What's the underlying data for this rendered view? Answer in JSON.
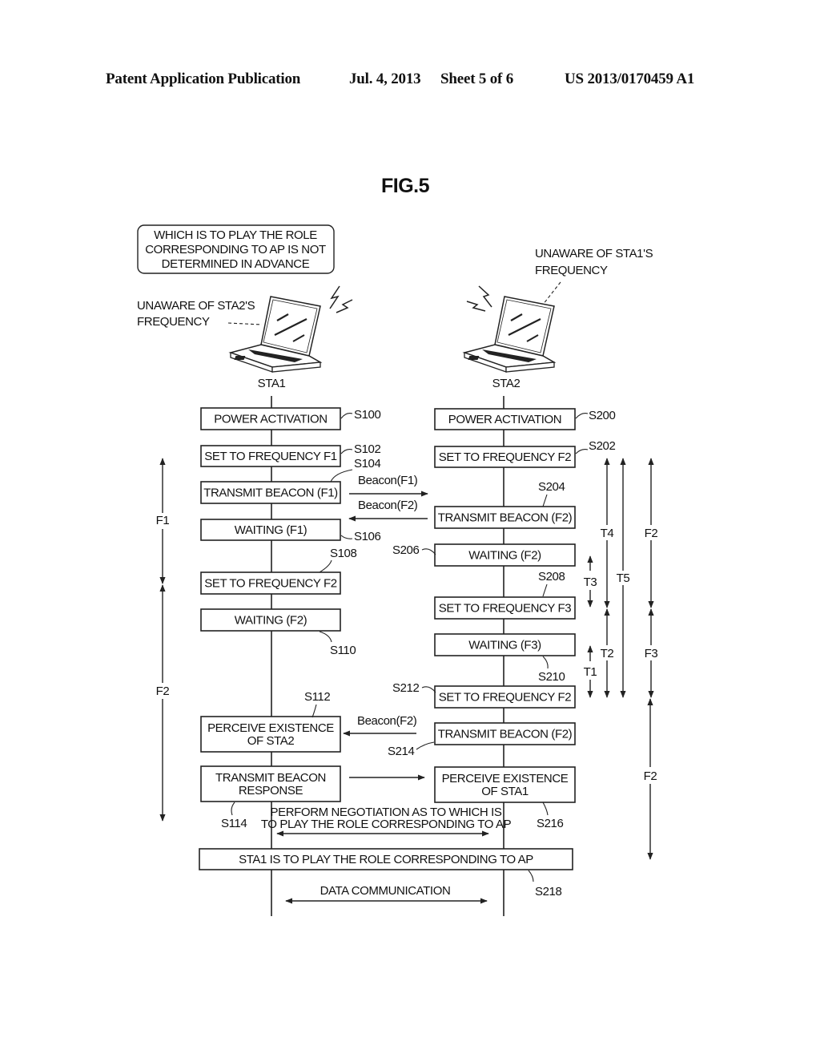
{
  "header": {
    "publication": "Patent Application Publication",
    "date": "Jul. 4, 2013",
    "sheet": "Sheet 5 of 6",
    "number": "US 2013/0170459 A1"
  },
  "figure": {
    "title": "FIG.5",
    "note_box": [
      "WHICH IS TO PLAY THE ROLE",
      "CORRESPONDING TO AP IS NOT",
      "DETERMINED IN ADVANCE"
    ],
    "sta1": {
      "label": "STA1",
      "note": [
        "UNAWARE OF STA2'S",
        "FREQUENCY"
      ],
      "icon": "laptop-icon"
    },
    "sta2": {
      "label": "STA2",
      "note": [
        "UNAWARE OF STA1'S",
        "FREQUENCY"
      ],
      "icon": "laptop-icon"
    },
    "sta1_steps": [
      {
        "id": "S100",
        "text": [
          "POWER ACTIVATION"
        ]
      },
      {
        "id": "S102",
        "text": [
          "SET TO FREQUENCY F1"
        ]
      },
      {
        "id": "S104",
        "text": [
          "TRANSMIT BEACON (F1)"
        ]
      },
      {
        "id": "S106",
        "text": [
          "WAITING (F1)"
        ]
      },
      {
        "id": "S108",
        "text": [
          "SET TO FREQUENCY F2"
        ]
      },
      {
        "id": "S110",
        "text": [
          "WAITING (F2)"
        ]
      },
      {
        "id": "S112",
        "text": [
          "PERCEIVE EXISTENCE",
          "OF STA2"
        ]
      },
      {
        "id": "S114",
        "text": [
          "TRANSMIT BEACON",
          "RESPONSE"
        ]
      }
    ],
    "sta2_steps": [
      {
        "id": "S200",
        "text": [
          "POWER ACTIVATION"
        ]
      },
      {
        "id": "S202",
        "text": [
          "SET TO FREQUENCY F2"
        ]
      },
      {
        "id": "S204",
        "text": [
          "TRANSMIT BEACON (F2)"
        ]
      },
      {
        "id": "S206",
        "text": [
          "WAITING (F2)"
        ]
      },
      {
        "id": "S208",
        "text": [
          "SET TO FREQUENCY F3"
        ]
      },
      {
        "id": "S210",
        "text": [
          "WAITING (F3)"
        ]
      },
      {
        "id": "S212",
        "text": [
          "SET TO FREQUENCY F2"
        ]
      },
      {
        "id": "S214",
        "text": [
          "TRANSMIT BEACON (F2)"
        ]
      },
      {
        "id": "S216",
        "text": [
          "PERCEIVE EXISTENCE",
          "OF STA1"
        ]
      }
    ],
    "shared_step": {
      "id": "S218",
      "text": "STA1 IS TO PLAY THE ROLE CORRESPONDING TO AP"
    },
    "messages": {
      "beacon_f1": "Beacon(F1)",
      "beacon_f2_a": "Beacon(F2)",
      "beacon_f2_b": "Beacon(F2)",
      "negotiation": [
        "PERFORM NEGOTIATION AS TO WHICH IS",
        "TO PLAY THE ROLE CORRESPONDING TO AP"
      ],
      "data": "DATA COMMUNICATION"
    },
    "left_intervals": [
      "F1",
      "F2"
    ],
    "right_intervals": {
      "T4": "T4",
      "T5": "T5",
      "T3": "T3",
      "T2": "T2",
      "T1": "T1",
      "F2a": "F2",
      "F3": "F3",
      "F2b": "F2"
    }
  }
}
